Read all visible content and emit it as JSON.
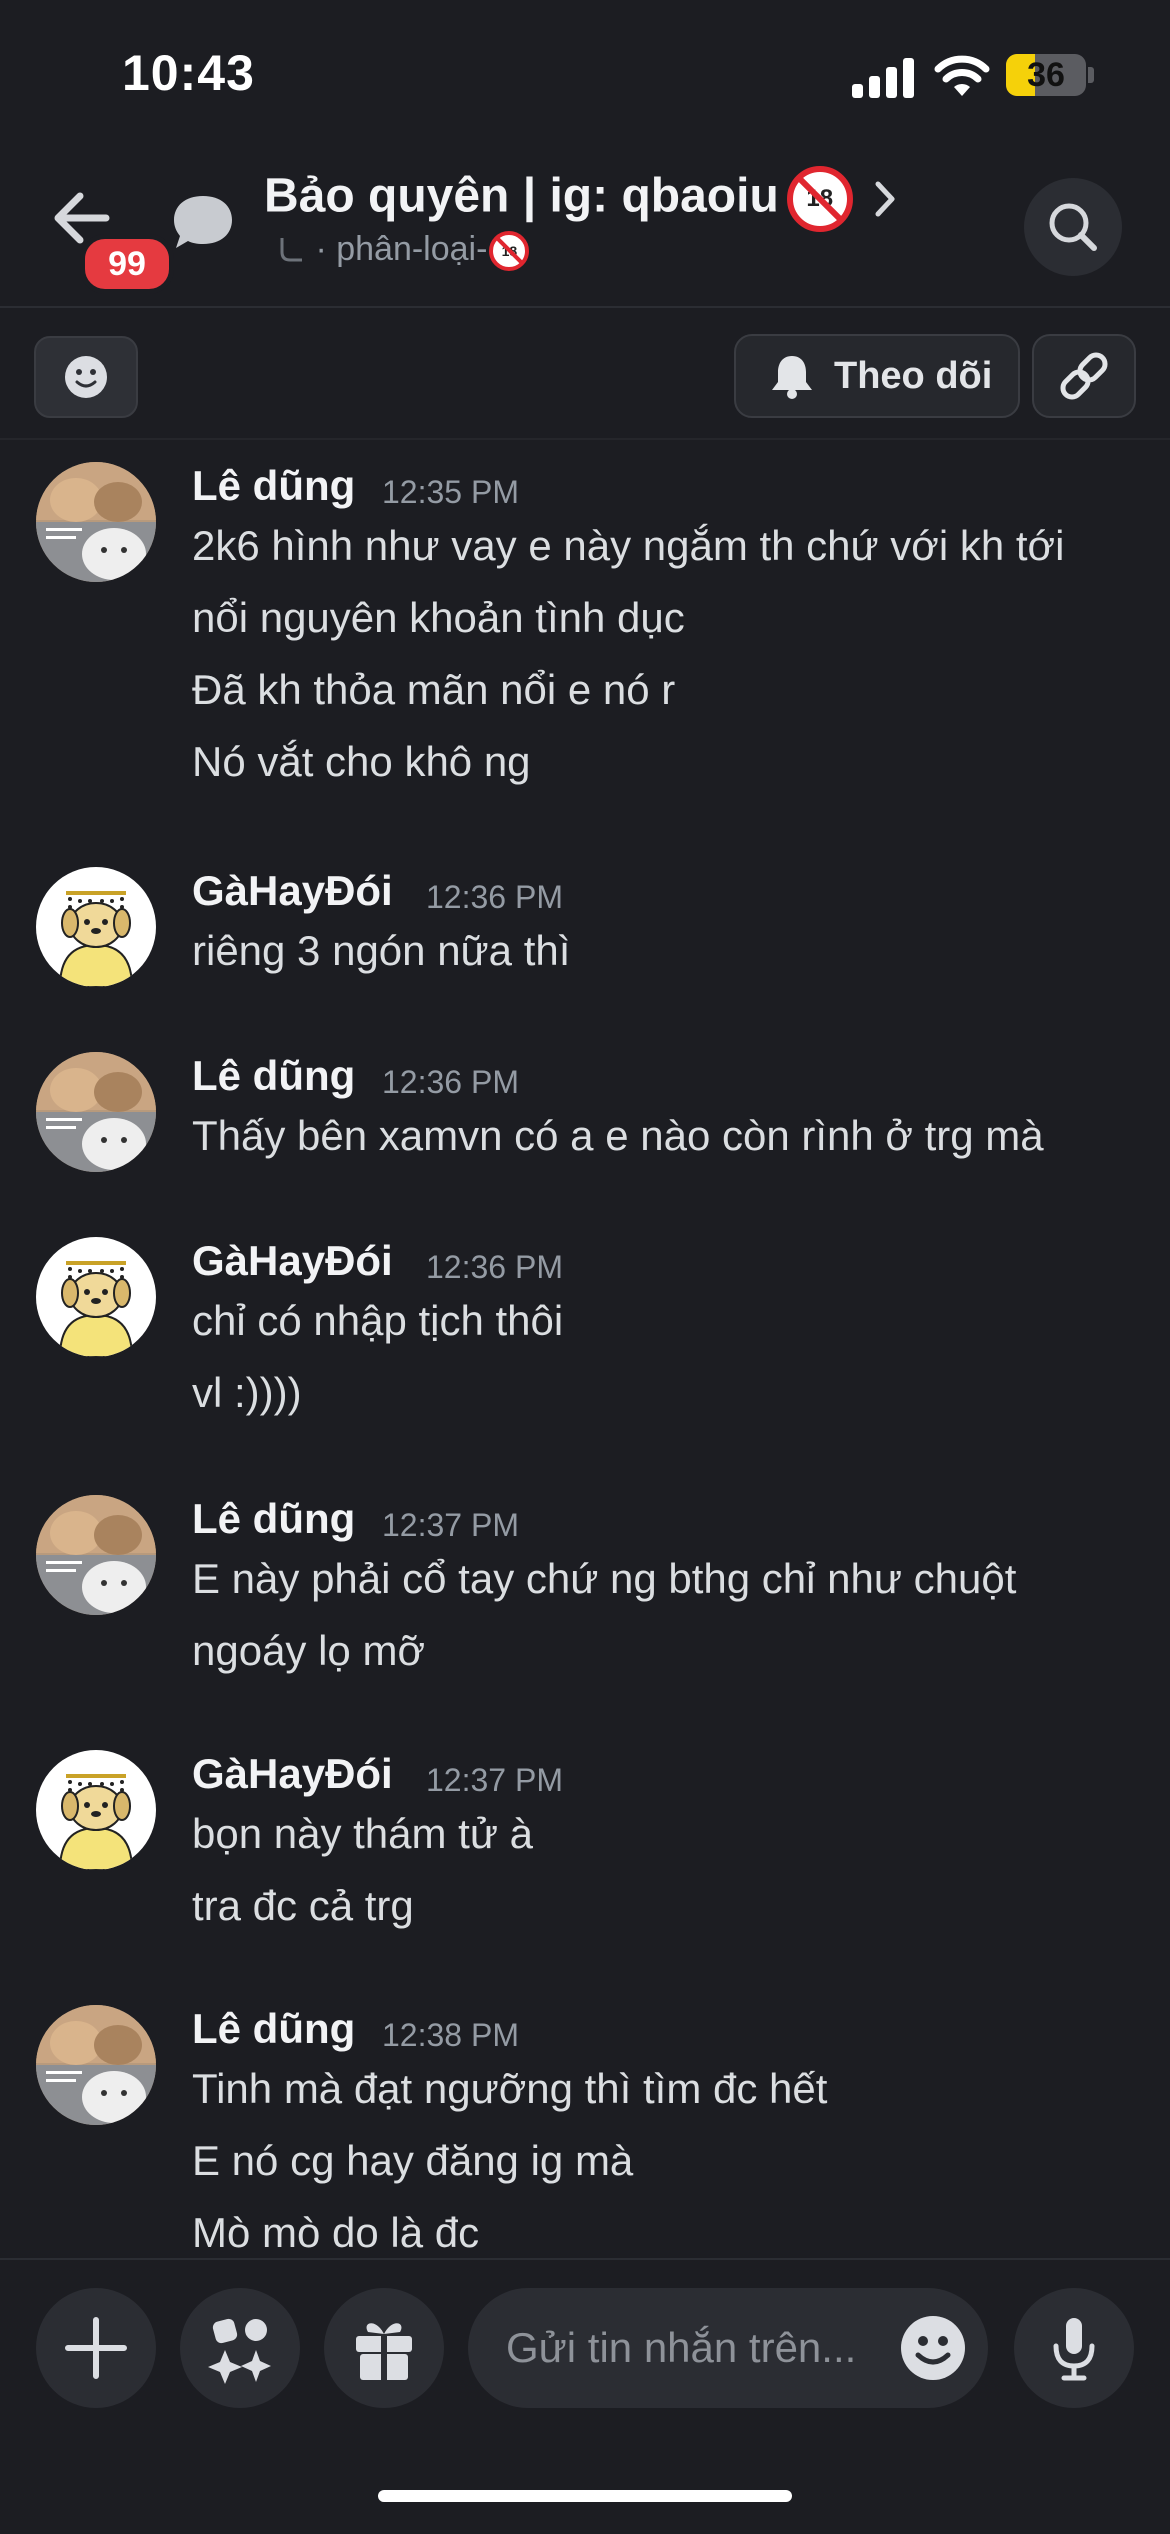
{
  "status": {
    "time": "10:43",
    "battery": "36",
    "battery_level": 0.36
  },
  "header": {
    "back_badge": "99",
    "title": "Bảo quyên | ig: qbaoiu",
    "title_emoji": "🔞",
    "subtitle": "· phân-loại-",
    "subtitle_emoji": "🔞"
  },
  "toolbar": {
    "follow_label": "Theo dõi"
  },
  "messages": [
    {
      "author": "Lê dũng",
      "time": "12:35 PM",
      "avatar": "cats",
      "lines": [
        "2k6 hình như vay e này ngắm th chứ với kh tới",
        "nổi nguyên khoản tình dục",
        "Đã kh thỏa mãn nổi e nó r",
        "Nó vắt cho khô ng"
      ]
    },
    {
      "author": "GàHayĐói",
      "time": "12:36 PM",
      "avatar": "dog",
      "lines": [
        "riêng 3 ngón nữa thì"
      ]
    },
    {
      "author": "Lê dũng",
      "time": "12:36 PM",
      "avatar": "cats",
      "lines": [
        "Thấy bên xamvn có a e nào còn rình ở trg mà"
      ]
    },
    {
      "author": "GàHayĐói",
      "time": "12:36 PM",
      "avatar": "dog",
      "lines": [
        "chỉ có nhập tịch thôi",
        "vl :))))"
      ]
    },
    {
      "author": "Lê dũng",
      "time": "12:37 PM",
      "avatar": "cats",
      "lines": [
        "E này phải cổ tay chứ ng bthg chỉ như chuột",
        "ngoáy lọ mỡ"
      ]
    },
    {
      "author": "GàHayĐói",
      "time": "12:37 PM",
      "avatar": "dog",
      "lines": [
        "bọn này thám tử à",
        "tra đc cả trg"
      ]
    },
    {
      "author": "Lê dũng",
      "time": "12:38 PM",
      "avatar": "cats",
      "lines": [
        "Tinh mà đạt ngưỡng thì tìm đc hết",
        "E nó cg hay đăng ig mà",
        "Mò mò do là đc"
      ]
    }
  ],
  "composer": {
    "placeholder": "Gửi tin nhắn trên..."
  }
}
